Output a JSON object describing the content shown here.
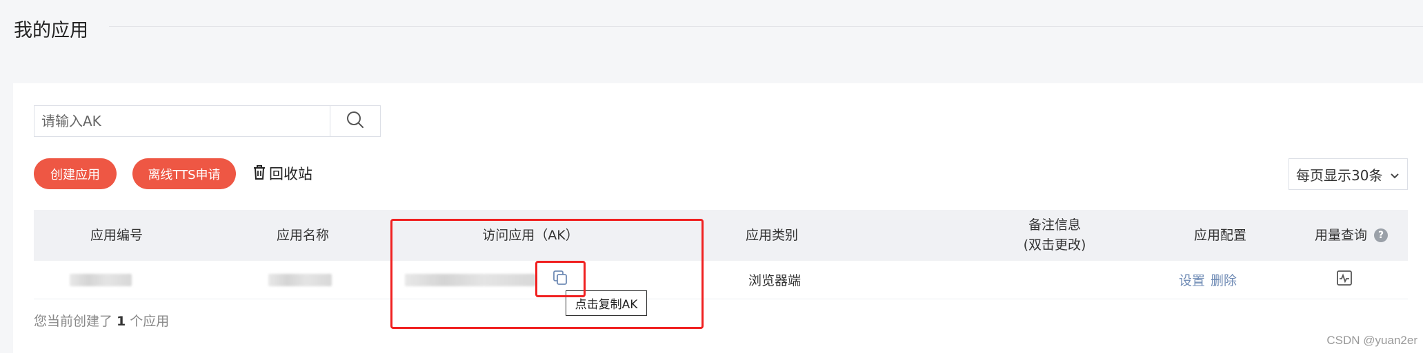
{
  "header": {
    "title": "我的应用"
  },
  "search": {
    "placeholder": "请输入AK"
  },
  "toolbar": {
    "create_label": "创建应用",
    "offline_tts_label": "离线TTS申请",
    "recycle_label": "回收站",
    "per_page_label": "每页显示30条"
  },
  "table": {
    "headers": {
      "app_id": "应用编号",
      "app_name": "应用名称",
      "access_ak": "访问应用（AK）",
      "app_type": "应用类别",
      "remark_line1": "备注信息",
      "remark_line2": "(双击更改)",
      "config": "应用配置",
      "usage": "用量查询"
    },
    "rows": [
      {
        "app_type": "浏览器端",
        "config_actions": [
          "设置",
          "删除"
        ]
      }
    ]
  },
  "tooltip": {
    "text": "点击复制AK"
  },
  "footer": {
    "prefix": "您当前创建了",
    "count": "1",
    "suffix": "个应用"
  },
  "watermark": {
    "text": "CSDN @yuan2er"
  },
  "colors": {
    "accent": "#ee5744",
    "highlight_border": "#f02020",
    "link": "#6f8bb5"
  },
  "icons": {
    "search": "search-icon",
    "recycle": "trash-icon",
    "copy": "copy-icon",
    "help": "help-icon",
    "usage": "activity-chart-icon",
    "dropdown": "chevron-down-icon"
  }
}
